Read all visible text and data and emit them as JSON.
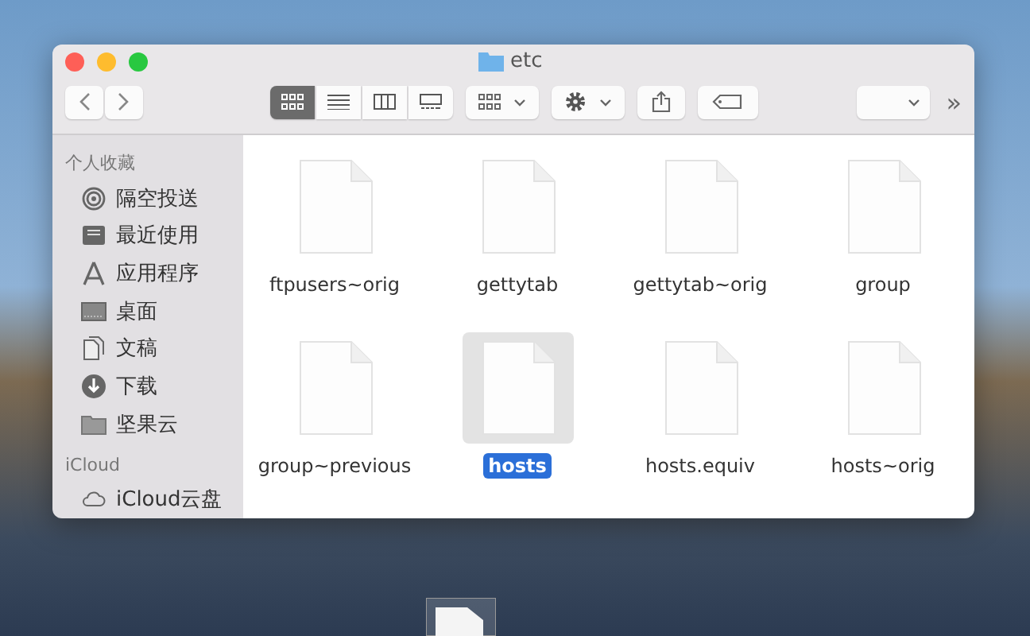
{
  "window": {
    "title": "etc"
  },
  "toolbar": {
    "view_modes": [
      {
        "kind": "icons",
        "selected": true
      },
      {
        "kind": "list",
        "selected": false
      },
      {
        "kind": "columns",
        "selected": false
      },
      {
        "kind": "gallery",
        "selected": false
      }
    ],
    "overflow": "»"
  },
  "sidebar": {
    "sections": [
      {
        "heading": "个人收藏",
        "items": [
          {
            "label": "隔空投送",
            "kind": "airdrop"
          },
          {
            "label": "最近使用",
            "kind": "recents"
          },
          {
            "label": "应用程序",
            "kind": "apps"
          },
          {
            "label": "桌面",
            "kind": "desktop"
          },
          {
            "label": "文稿",
            "kind": "documents"
          },
          {
            "label": "下载",
            "kind": "downloads"
          },
          {
            "label": "坚果云",
            "kind": "folder"
          }
        ]
      },
      {
        "heading": "iCloud",
        "items": [
          {
            "label": "iCloud云盘",
            "kind": "cloud"
          }
        ]
      }
    ]
  },
  "files": [
    {
      "name": "ftpusers~orig",
      "selected": false
    },
    {
      "name": "gettytab",
      "selected": false
    },
    {
      "name": "gettytab~orig",
      "selected": false
    },
    {
      "name": "group",
      "selected": false
    },
    {
      "name": "group~previous",
      "selected": false
    },
    {
      "name": "hosts",
      "selected": true
    },
    {
      "name": "hosts.equiv",
      "selected": false
    },
    {
      "name": "hosts~orig",
      "selected": false
    }
  ]
}
